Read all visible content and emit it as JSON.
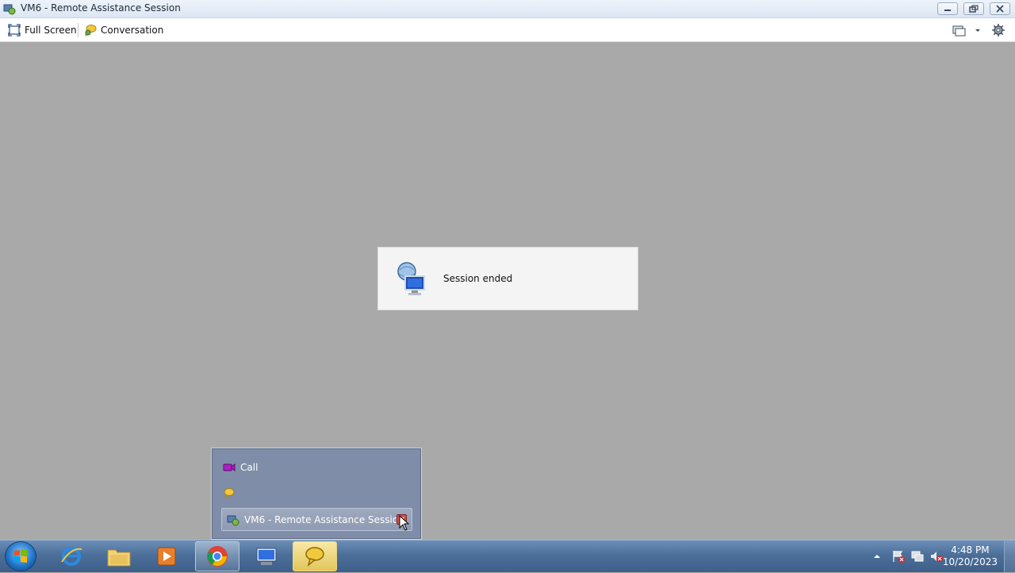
{
  "window": {
    "title": "VM6 - Remote Assistance Session"
  },
  "toolbar": {
    "full_screen_label": "Full Screen",
    "conversation_label": "Conversation"
  },
  "dialog": {
    "message": "Session ended"
  },
  "jumplist": {
    "call_label": "Call",
    "window_item_label": "VM6 - Remote Assistance Session"
  },
  "taskbar": {
    "pinned": [
      "internet-explorer",
      "windows-explorer",
      "media-player",
      "chrome",
      "remote-assistance",
      "messenger"
    ]
  },
  "clock": {
    "time": "4:48 PM",
    "date": "10/20/2023"
  },
  "colors": {
    "desktop": "#a9a9a9",
    "jumplist_bg": "#7f8da8",
    "taskbar": "#4c6f99",
    "call_icon": "#b01ec8",
    "bubble_icon": "#f2c83c"
  }
}
